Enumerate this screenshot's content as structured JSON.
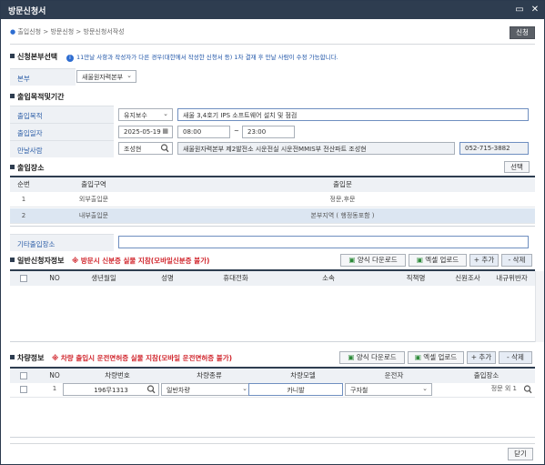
{
  "window": {
    "title": "방문신청서",
    "minimize": "▭",
    "close": "✕"
  },
  "breadcrumb": {
    "items": [
      "출입신청",
      "방문신청",
      "방문신청서작성"
    ],
    "sep": " > "
  },
  "actions": {
    "apply_label": "신청",
    "close_label": "닫기"
  },
  "section_applicant": {
    "title": "신청본부선택",
    "info": "11만날 사항과 작성자가 다른 경우(대한에서 작성한 신청서 등) 1차 결재  후 만날 사람이 수정 가능합니다.",
    "hq_label": "본부",
    "hq_value": "새울원자력본부"
  },
  "section_purpose": {
    "title": "출입목적및기간",
    "purpose_label": "출입목적",
    "purpose_select": "유지보수",
    "purpose_text": "새울 3,4호기 IPS 소프트웨어 설치 및 점검",
    "date_label": "출입일자",
    "date": "2025-05-19",
    "time_start": "08:00",
    "tilde": "~",
    "time_end": "23:00",
    "meet_label": "만날사람",
    "meet_name": "조성현",
    "meet_org": "새울원자력본부 제2발전소 시운전실 시운전MMIS부 전산파트 조성현",
    "meet_phone": "052-715-3882"
  },
  "section_place": {
    "title": "출입장소",
    "select_label": "선택",
    "headers": [
      "순번",
      "출입구역",
      "출입문"
    ],
    "rows": [
      {
        "no": "1",
        "zone": "외부출입문",
        "gate": "정문,후문"
      },
      {
        "no": "2",
        "zone": "내부출입문",
        "gate": "본부지역 ( 행정동포함 )"
      }
    ],
    "other_label": "기타출입장소",
    "other_value": ""
  },
  "section_general": {
    "title": "일반신청자정보",
    "warning": "※ 방문시 신분증 실물 지참(모바일신분증 불가)",
    "btn_download": "양식 다운로드",
    "btn_upload": "엑셀 업로드",
    "btn_add": "+ 추가",
    "btn_delete": "- 삭제",
    "headers": [
      "NO",
      "생년월일",
      "성명",
      "휴대전화",
      "소속",
      "직책명",
      "신원조사",
      "내규위반자"
    ]
  },
  "section_vehicle": {
    "title": "차량정보",
    "warning": "※ 차량 출입시 운전면허증 실물 지참(모바일 운전면허증 불가)",
    "btn_download": "양식 다운로드",
    "btn_upload": "엑셀 업로드",
    "btn_add": "+ 추가",
    "btn_delete": "- 삭제",
    "headers": [
      "NO",
      "차량번호",
      "차량종류",
      "차량모델",
      "운전자",
      "출입장소"
    ],
    "rows": [
      {
        "no": "1",
        "plate": "196무1313",
        "type": "일반차량",
        "model": "카니발",
        "driver": "구자철",
        "place": "정문 외 1"
      }
    ]
  },
  "colors": {
    "titlebar": "#2e3d50",
    "label_bg": "#eef1f5",
    "label_text": "#2e5fa8",
    "warning": "#d0242b",
    "selected_row": "#dce6f2"
  }
}
